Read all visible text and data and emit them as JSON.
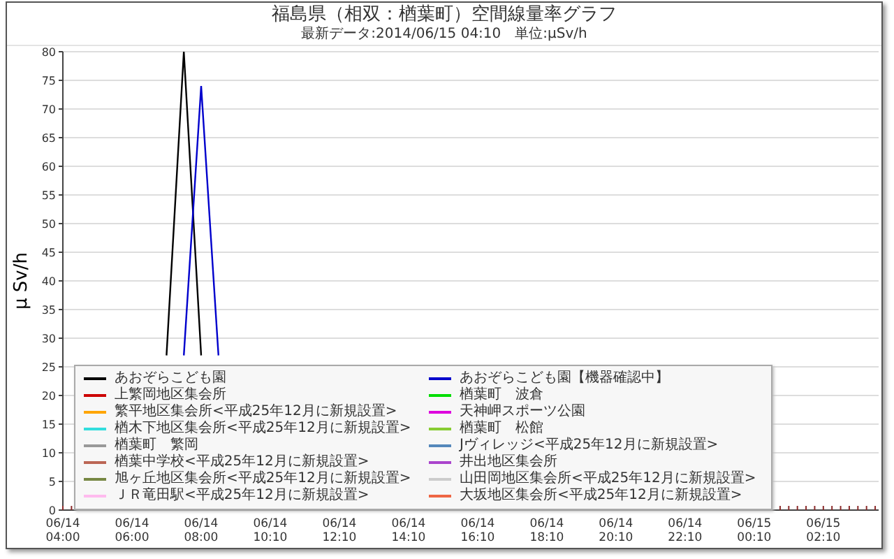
{
  "header": {
    "title": "福島県（相双：楢葉町）空間線量率グラフ",
    "subtitle": "最新データ:2014/06/15 04:10　単位:μSv/h"
  },
  "chart": {
    "chart_data": {
      "type": "line",
      "ylabel": "μ Sv/h",
      "ylim": [
        0,
        80
      ],
      "grid": true,
      "legend": true,
      "yticks": [
        0,
        5,
        10,
        15,
        20,
        25,
        30,
        35,
        40,
        45,
        50,
        55,
        60,
        65,
        70,
        75,
        80
      ],
      "categories": [
        "06/14 04:00",
        null,
        null,
        null,
        "06/14 06:00",
        null,
        null,
        null,
        "06/14 08:00",
        null,
        null,
        null,
        "06/14 10:10",
        null,
        null,
        null,
        "06/14 12:10",
        null,
        null,
        null,
        "06/14 14:10",
        null,
        null,
        null,
        "06/14 16:10",
        null,
        null,
        null,
        "06/14 18:10",
        null,
        null,
        null,
        "06/14 20:10",
        null,
        null,
        null,
        "06/14 22:10",
        null,
        null,
        null,
        "06/15 00:10",
        null,
        null,
        null,
        "06/15 02:10",
        null,
        null,
        null
      ],
      "series": [
        {
          "name": "あおぞらこども園",
          "color": "#000000",
          "values": [
            null,
            null,
            null,
            null,
            null,
            null,
            27,
            80,
            27,
            null,
            null,
            null,
            null,
            null,
            null,
            null,
            null,
            null,
            null,
            null,
            null,
            null,
            null,
            null,
            null,
            null,
            null,
            null,
            null,
            null,
            null,
            null,
            null,
            null,
            null,
            null,
            null,
            null,
            null,
            null,
            null,
            null,
            null,
            null,
            null,
            null,
            null,
            null
          ]
        },
        {
          "name": "あおぞらこども園【機器確認中】",
          "color": "#0000cc",
          "values": [
            null,
            null,
            null,
            null,
            null,
            null,
            null,
            27,
            74,
            27,
            null,
            null,
            null,
            null,
            null,
            null,
            null,
            null,
            null,
            null,
            null,
            null,
            null,
            null,
            null,
            null,
            null,
            null,
            null,
            null,
            null,
            null,
            null,
            null,
            null,
            null,
            null,
            null,
            null,
            null,
            null,
            null,
            null,
            null,
            null,
            null,
            null,
            null
          ]
        },
        {
          "name": "上繁岡地区集会所",
          "color": "#cc0000",
          "values": [
            null,
            null,
            null,
            null,
            null,
            null,
            null,
            null,
            null,
            null,
            null,
            null,
            null,
            null,
            null,
            null,
            null,
            null,
            null,
            null,
            null,
            null,
            null,
            null,
            null,
            null,
            null,
            null,
            null,
            null,
            null,
            null,
            null,
            null,
            null,
            null,
            null,
            null,
            null,
            null,
            null,
            null,
            null,
            null,
            null,
            null,
            null,
            null
          ]
        },
        {
          "name": "楢葉町　波倉",
          "color": "#00dd00",
          "values": [
            null,
            null,
            null,
            null,
            null,
            null,
            null,
            null,
            null,
            null,
            null,
            null,
            null,
            null,
            null,
            null,
            null,
            null,
            null,
            null,
            null,
            null,
            null,
            null,
            null,
            null,
            null,
            null,
            null,
            null,
            null,
            null,
            null,
            null,
            null,
            null,
            null,
            null,
            null,
            null,
            null,
            null,
            null,
            null,
            null,
            null,
            null,
            null
          ]
        },
        {
          "name": "繁平地区集会所<平成25年12月に新規設置>",
          "color": "#ffa500",
          "values": [
            null,
            null,
            null,
            null,
            null,
            null,
            null,
            null,
            null,
            null,
            null,
            null,
            null,
            null,
            null,
            null,
            null,
            null,
            null,
            null,
            null,
            null,
            null,
            null,
            null,
            null,
            null,
            null,
            null,
            null,
            null,
            null,
            null,
            null,
            null,
            null,
            null,
            null,
            null,
            null,
            null,
            null,
            null,
            null,
            null,
            null,
            null,
            null
          ]
        },
        {
          "name": "天神岬スポーツ公園",
          "color": "#dd00dd",
          "values": [
            null,
            null,
            null,
            null,
            null,
            null,
            null,
            null,
            null,
            null,
            null,
            null,
            null,
            null,
            null,
            null,
            null,
            null,
            null,
            null,
            null,
            null,
            null,
            null,
            null,
            null,
            null,
            null,
            null,
            null,
            null,
            null,
            null,
            null,
            null,
            null,
            null,
            null,
            null,
            null,
            null,
            null,
            null,
            null,
            null,
            null,
            null,
            null
          ]
        },
        {
          "name": "楢木下地区集会所<平成25年12月に新規設置>",
          "color": "#33dddd",
          "values": [
            null,
            null,
            null,
            null,
            null,
            null,
            null,
            null,
            null,
            null,
            null,
            null,
            null,
            null,
            null,
            null,
            null,
            null,
            null,
            null,
            null,
            null,
            null,
            null,
            null,
            null,
            null,
            null,
            null,
            null,
            null,
            null,
            null,
            null,
            null,
            null,
            null,
            null,
            null,
            null,
            null,
            null,
            null,
            null,
            null,
            null,
            null,
            null
          ]
        },
        {
          "name": "楢葉町　松館",
          "color": "#88cc33",
          "values": [
            null,
            null,
            null,
            null,
            null,
            null,
            null,
            null,
            null,
            null,
            null,
            null,
            null,
            null,
            null,
            null,
            null,
            null,
            null,
            null,
            null,
            null,
            null,
            null,
            null,
            null,
            null,
            null,
            null,
            null,
            null,
            null,
            null,
            null,
            null,
            null,
            null,
            null,
            null,
            null,
            null,
            null,
            null,
            null,
            null,
            null,
            null,
            null
          ]
        },
        {
          "name": "楢葉町　繁岡",
          "color": "#999999",
          "values": [
            null,
            null,
            null,
            null,
            null,
            null,
            null,
            null,
            null,
            null,
            null,
            null,
            null,
            null,
            null,
            null,
            null,
            null,
            null,
            null,
            null,
            null,
            null,
            null,
            null,
            null,
            null,
            null,
            null,
            null,
            null,
            null,
            null,
            null,
            null,
            null,
            null,
            null,
            null,
            null,
            null,
            null,
            null,
            null,
            null,
            null,
            null,
            null
          ]
        },
        {
          "name": "Jヴィレッジ<平成25年12月に新規設置>",
          "color": "#5588bb",
          "values": [
            null,
            null,
            null,
            null,
            null,
            null,
            null,
            null,
            null,
            null,
            null,
            null,
            null,
            null,
            null,
            null,
            null,
            null,
            null,
            null,
            null,
            null,
            null,
            null,
            null,
            null,
            null,
            null,
            null,
            null,
            null,
            null,
            null,
            null,
            null,
            null,
            null,
            null,
            null,
            null,
            null,
            null,
            null,
            null,
            null,
            null,
            null,
            null
          ]
        },
        {
          "name": "楢葉中学校<平成25年12月に新規設置>",
          "color": "#bb6655",
          "values": [
            null,
            null,
            null,
            null,
            null,
            null,
            null,
            null,
            null,
            null,
            null,
            null,
            null,
            null,
            null,
            null,
            null,
            null,
            null,
            null,
            null,
            null,
            null,
            null,
            null,
            null,
            null,
            null,
            null,
            null,
            null,
            null,
            null,
            null,
            null,
            null,
            null,
            null,
            null,
            null,
            null,
            null,
            null,
            null,
            null,
            null,
            null,
            null
          ]
        },
        {
          "name": "井出地区集会所",
          "color": "#aa44cc",
          "values": [
            null,
            null,
            null,
            null,
            null,
            null,
            null,
            null,
            null,
            null,
            null,
            null,
            null,
            null,
            null,
            null,
            null,
            null,
            null,
            null,
            null,
            null,
            null,
            null,
            null,
            null,
            null,
            null,
            null,
            null,
            null,
            null,
            null,
            null,
            null,
            null,
            null,
            null,
            null,
            null,
            null,
            null,
            null,
            null,
            null,
            null,
            null,
            null
          ]
        },
        {
          "name": "旭ヶ丘地区集会所<平成25年12月に新規設置>",
          "color": "#778844",
          "values": [
            null,
            null,
            null,
            null,
            null,
            null,
            null,
            null,
            null,
            null,
            null,
            null,
            null,
            null,
            null,
            null,
            null,
            null,
            null,
            null,
            null,
            null,
            null,
            null,
            null,
            null,
            null,
            null,
            null,
            null,
            null,
            null,
            null,
            null,
            null,
            null,
            null,
            null,
            null,
            null,
            null,
            null,
            null,
            null,
            null,
            null,
            null,
            null
          ]
        },
        {
          "name": "山田岡地区集会所<平成25年12月に新規設置>",
          "color": "#cccccc",
          "values": [
            null,
            null,
            null,
            null,
            null,
            null,
            null,
            null,
            null,
            null,
            null,
            null,
            null,
            null,
            null,
            null,
            null,
            null,
            null,
            null,
            null,
            null,
            null,
            null,
            null,
            null,
            null,
            null,
            null,
            null,
            null,
            null,
            null,
            null,
            null,
            null,
            null,
            null,
            null,
            null,
            null,
            null,
            null,
            null,
            null,
            null,
            null,
            null
          ]
        },
        {
          "name": "ＪＲ竜田駅<平成25年12月に新規設置>",
          "color": "#ffbbee",
          "values": [
            null,
            null,
            null,
            null,
            null,
            null,
            null,
            null,
            null,
            null,
            null,
            null,
            null,
            null,
            null,
            null,
            null,
            null,
            null,
            null,
            null,
            null,
            null,
            null,
            null,
            null,
            null,
            null,
            null,
            null,
            null,
            null,
            null,
            null,
            null,
            null,
            null,
            null,
            null,
            null,
            null,
            null,
            null,
            null,
            null,
            null,
            null,
            null
          ]
        },
        {
          "name": "大坂地区集会所<平成25年12月に新規設置>",
          "color": "#ee6644",
          "values": [
            null,
            null,
            null,
            null,
            null,
            null,
            null,
            null,
            null,
            null,
            null,
            null,
            null,
            null,
            null,
            null,
            null,
            null,
            null,
            null,
            null,
            null,
            null,
            null,
            null,
            null,
            null,
            null,
            null,
            null,
            null,
            null,
            null,
            null,
            null,
            null,
            null,
            null,
            null,
            null,
            null,
            null,
            null,
            null,
            null,
            null,
            null,
            null
          ]
        }
      ]
    }
  }
}
